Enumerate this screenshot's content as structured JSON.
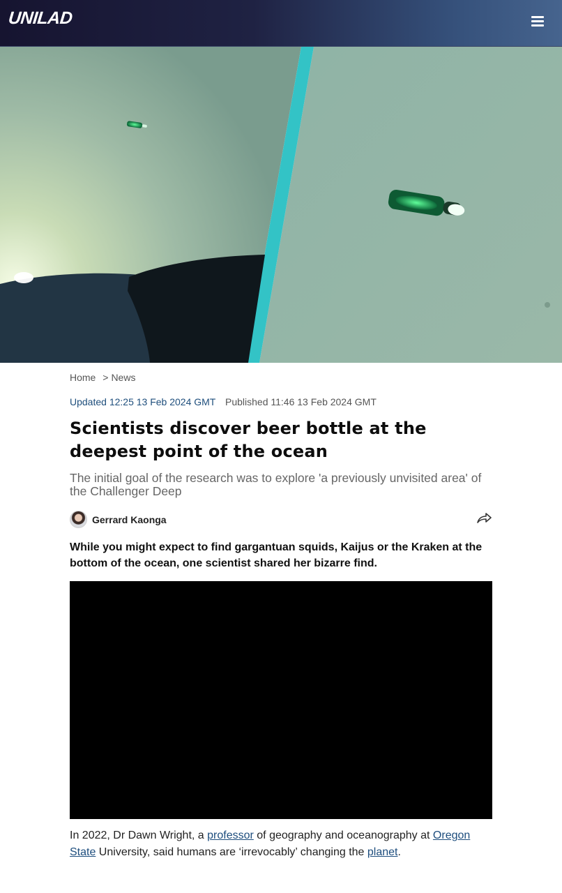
{
  "header": {
    "logo": "UNILAD",
    "menu_icon": "hamburger-menu-icon"
  },
  "hero": {
    "image_icon": "hero-image"
  },
  "breadcrumb": {
    "home": "Home",
    "separator": ">",
    "section": "News"
  },
  "dates": {
    "updated": "Updated 12:25 13 Feb 2024 GMT",
    "published": "Published 11:46 13 Feb 2024 GMT"
  },
  "article": {
    "title": "Scientists discover beer bottle at the deepest point of the ocean",
    "subtitle": "The initial goal of the research was to explore 'a previously unvisited area' of the Challenger Deep",
    "lead": "While you might expect to find gargantuan squids, Kaijus or the Kraken at the bottom of the ocean, one scientist shared her bizarre find.",
    "body": {
      "t1": "In 2022, Dr Dawn Wright, a ",
      "link1": "professor",
      "t2": " of geography and oceanography at ",
      "link2": "Oregon State",
      "t3": " University, said humans are ‘irrevocably’ changing the ",
      "link3": "planet",
      "t4": "."
    }
  },
  "author": {
    "name": "Gerrard Kaonga",
    "share_icon": "share-icon"
  },
  "colors": {
    "link": "#1d4d7d",
    "header_start": "#161430",
    "header_end": "#46648e",
    "video_bg": "#000000"
  }
}
